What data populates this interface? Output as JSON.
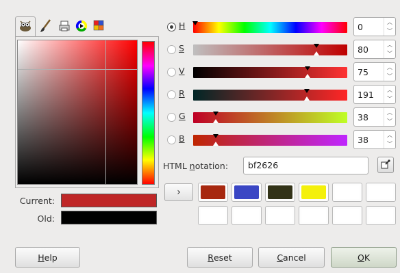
{
  "selector_tabs": [
    {
      "icon": "gimp-wilber-icon",
      "active": true
    },
    {
      "icon": "paintbrush-icon",
      "active": false
    },
    {
      "icon": "cmyk-printer-icon",
      "active": false
    },
    {
      "icon": "color-wheel-icon",
      "active": false
    },
    {
      "icon": "palette-icon",
      "active": false
    }
  ],
  "preview": {
    "current_label": "Current:",
    "old_label": "Old:",
    "current_color": "#bf2626",
    "old_color": "#000000"
  },
  "channels": [
    {
      "key": "H",
      "value": "0",
      "selected": true
    },
    {
      "key": "S",
      "value": "80",
      "selected": false
    },
    {
      "key": "V",
      "value": "75",
      "selected": false
    },
    {
      "key": "R",
      "value": "191",
      "selected": false
    },
    {
      "key": "G",
      "value": "38",
      "selected": false
    },
    {
      "key": "B",
      "value": "38",
      "selected": false
    }
  ],
  "html_notation": {
    "label_pre": "HTML ",
    "label_u": "n",
    "label_post": "otation:",
    "value": "bf2626"
  },
  "history": {
    "arrow": "›",
    "colors": [
      "#a7280f",
      "#3a46c4",
      "#333318",
      "#f4f00b",
      "#ffffff",
      "#ffffff",
      "#ffffff",
      "#ffffff",
      "#ffffff",
      "#ffffff",
      "#ffffff",
      "#ffffff"
    ]
  },
  "buttons": {
    "help_u": "H",
    "help_rest": "elp",
    "reset_u": "R",
    "reset_rest": "eset",
    "cancel_u": "C",
    "cancel_rest": "ancel",
    "ok_u": "O",
    "ok_rest": "K"
  }
}
